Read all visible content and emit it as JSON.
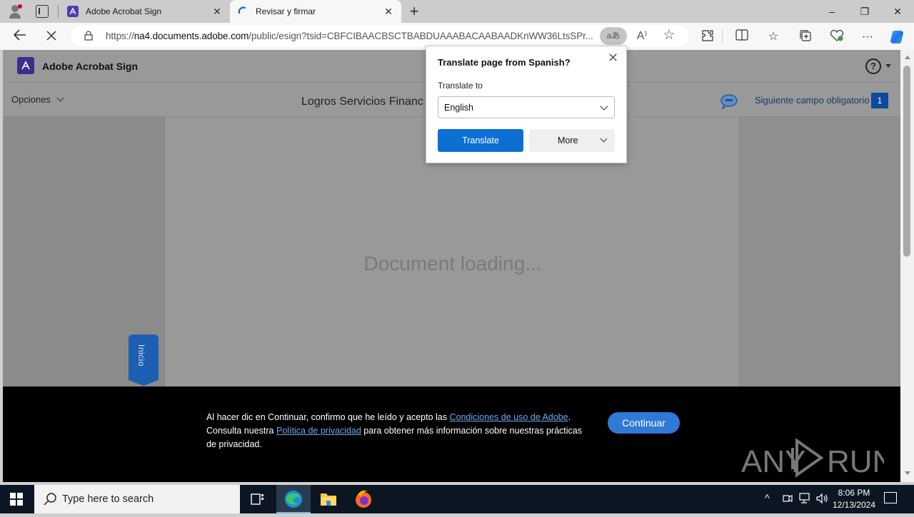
{
  "browser": {
    "tabs": [
      {
        "title": "Adobe Acrobat Sign",
        "icon": "acrobat-icon",
        "active": false
      },
      {
        "title": "Revisar y firmar",
        "icon": "loading-spinner-icon",
        "active": true
      }
    ],
    "new_tab_label": "+",
    "window_controls": {
      "minimize": "–",
      "restore": "❐",
      "close": "✕"
    },
    "url": {
      "scheme": "https://",
      "host": "na4.documents.adobe.com",
      "path": "/public/esign?tsid=CBFCIBAACBSCTBABDUAAABACAABAADKnWW36LtsSPr..."
    },
    "translate_pill": "aあ",
    "read_aloud": "A⁾",
    "favorite": "☆"
  },
  "translate_popup": {
    "title": "Translate page from  Spanish?",
    "label": "Translate to",
    "selected_language": "English",
    "translate_button": "Translate",
    "more_button": "More",
    "close": "✕"
  },
  "app": {
    "name": "Adobe Acrobat Sign",
    "help": "?",
    "options_label": "Opciones",
    "document_title": "Logros Servicios Financ",
    "next_required_field": "Siguiente campo obligatorio",
    "next_required_count": "1",
    "loading_text": "Document loading...",
    "start_tab": "Inicio"
  },
  "banner": {
    "line1_prefix": "Al hacer dic en Continuar, confirmo que he leído y acepto las ",
    "terms_link": "Condiciones de uso de Adobe",
    "line1_suffix": ".",
    "line2_prefix": "Consulta nuestra ",
    "privacy_link": "Política de privacidad",
    "line2_suffix": " para obtener más información sobre nuestras prácticas de privacidad.",
    "continue_button": "Continuar"
  },
  "watermark": {
    "left": "ANY",
    "right": "RUN"
  },
  "taskbar": {
    "search_placeholder": "Type here to search",
    "time": "8:06 PM",
    "date": "12/13/2024"
  }
}
